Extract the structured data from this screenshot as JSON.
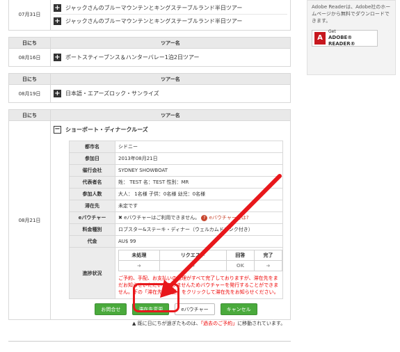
{
  "tours": [
    {
      "date": "07月31日",
      "items": [
        "ジャックさんのブルーマウンテンとキングステーブルランド半日ツアー",
        "ジャックさんのブルーマウンテンとキングステーブルランド半日ツアー"
      ]
    },
    {
      "date": "08月16日",
      "items": [
        "ポートスティーブンス＆ハンターバレー1泊2日ツアー"
      ]
    },
    {
      "date": "08月19日",
      "items": [
        "日本語・エアーズロック・サンライズ"
      ]
    },
    {
      "date": "08月21日",
      "items": [
        "ショーボート・ディナークルーズ"
      ]
    }
  ],
  "headers": {
    "date": "日にち",
    "tour": "ツアー名"
  },
  "detail": {
    "city_label": "都市名",
    "city": "シドニー",
    "date_label": "参加日",
    "date": "2013年08月21日",
    "company_label": "催行会社",
    "company": "SYDNEY SHOWBOAT",
    "rep_label": "代表者名",
    "rep": "姓： TEST 名：TEST 性別：MR",
    "people_label": "参加人数",
    "people": "大人： 1名様 子供：0名様 幼児：0名様",
    "stay_label": "滞在先",
    "stay": "未定です",
    "evoucher_label": "eバウチャー",
    "evoucher_text": "eバウチャーはご利用できません。",
    "evoucher_link": "eバウチャーとは?",
    "price_type_label": "料金種別",
    "price_type": "ロブスター&ステーキ・ディナー（ウェルカムドリンク付き）",
    "price_label": "代金",
    "price": "AU$ 99",
    "progress_label": "進捗状況",
    "progress_headers": [
      "未処理",
      "リクエスト",
      "回答",
      "完了"
    ],
    "progress_ok": "OK",
    "arrow_glyph": "➜",
    "warning": "ご予約、手配、お支払いの処理がすべて完了しておりますが、滞在先をまだお知らせいただいておりませんためバウチャーを発行することができません。下の「滞在先の変更」をクリックして滞在先をお知らせください。"
  },
  "buttons": {
    "inquiry": "お問合せ",
    "change_stay": "滞在先変更",
    "evoucher": "eバウチャー",
    "cancel": "キャンセル"
  },
  "note": {
    "prefix": "既に日にちが過ぎたものは、",
    "link": "「過去のご予約」",
    "suffix": "に移動されています。"
  },
  "sidebar": {
    "text": "Adobe Readerは、Adobe社のホームページから無料でダウンロードできます。",
    "badge_get": "Get",
    "badge_name": "ADOBE® READER®"
  },
  "colors": {
    "accent_green": "#4aaa3c",
    "warning_red": "#e00000",
    "highlight_red": "#e8171b"
  }
}
